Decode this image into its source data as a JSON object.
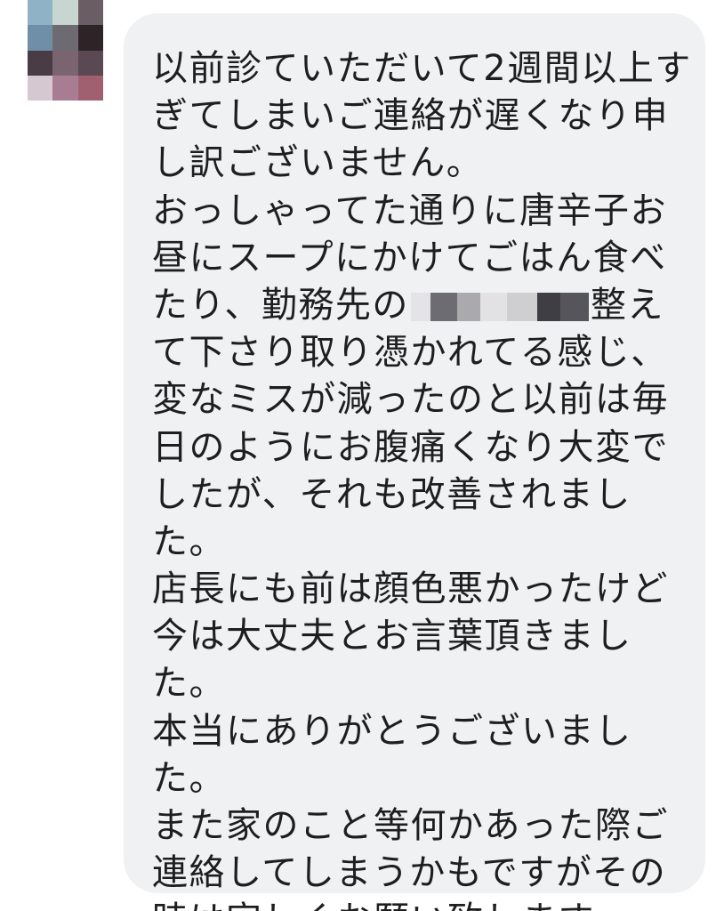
{
  "message": {
    "lines_top": [
      "以前診ていただいて2週間以上す",
      "ぎてしまいご連絡が遅くなり申",
      "し訳ございません。",
      "おっしゃってた通りに唐辛子お",
      "昼にスープにかけてごはん食べ"
    ],
    "redacted_line": {
      "before": "たり、勤務先の",
      "after": "整え"
    },
    "lines_bottom": [
      "て下さり取り憑かれてる感じ、",
      "変なミスが減ったのと以前は毎",
      "日のようにお腹痛くなり大変で",
      "したが、それも改善されまし",
      "た。",
      "店長にも前は顔色悪かったけど",
      "今は大丈夫とお言葉頂きまし",
      "た。",
      "本当にありがとうございまし",
      "た。",
      "また家のこと等何かあった際ご",
      "連絡してしまうかもですがその",
      "時は宜しくお願い致します。"
    ]
  },
  "colors": {
    "bubble_background": "#f0f1f3",
    "text": "#1e1e1e",
    "avatar_mosaic": [
      "#8fb2c6",
      "#c8d6d2",
      "#6a5e64",
      "#6e8fa6",
      "#6e6a72",
      "#2e2428",
      "#4a3c44",
      "#7a6470",
      "#5a4852",
      "#d6c8d0",
      "#a87c92",
      "#a06070"
    ]
  }
}
